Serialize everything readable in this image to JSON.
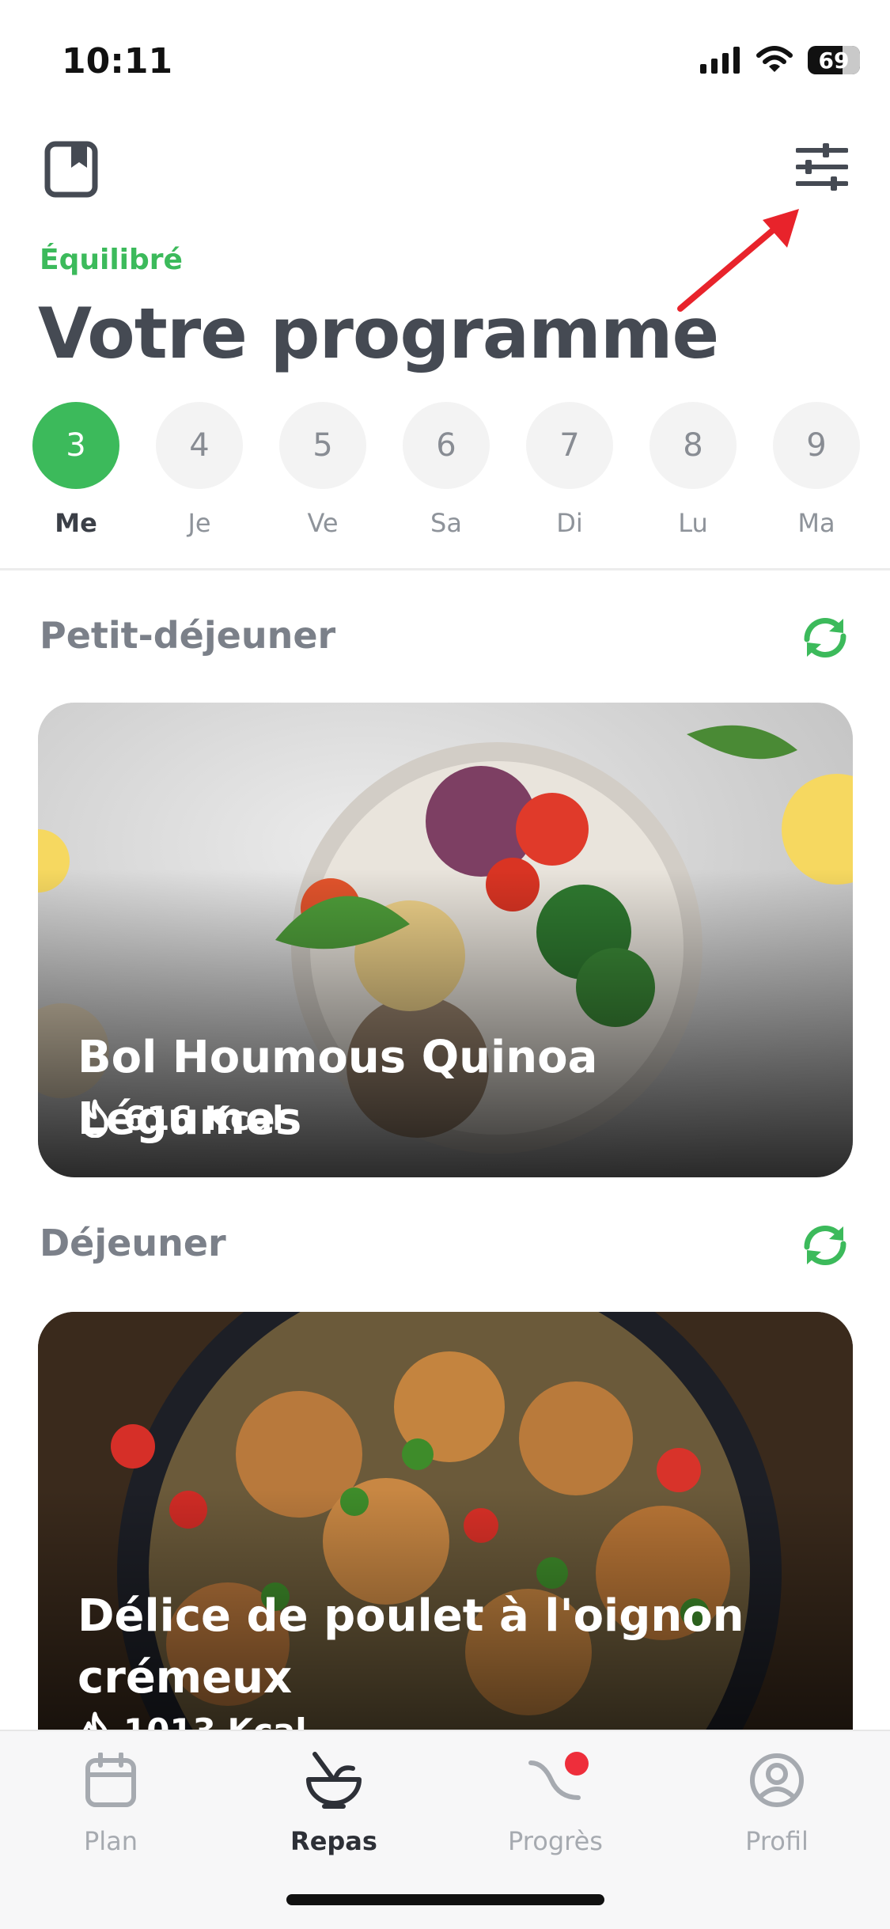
{
  "status_bar": {
    "time": "10:11",
    "battery": "69"
  },
  "header": {
    "subtitle": "Équilibré",
    "title": "Votre programme"
  },
  "days": [
    {
      "number": "3",
      "label": "Me",
      "active": true
    },
    {
      "number": "4",
      "label": "Je",
      "active": false
    },
    {
      "number": "5",
      "label": "Ve",
      "active": false
    },
    {
      "number": "6",
      "label": "Sa",
      "active": false
    },
    {
      "number": "7",
      "label": "Di",
      "active": false
    },
    {
      "number": "8",
      "label": "Lu",
      "active": false
    },
    {
      "number": "9",
      "label": "Ma",
      "active": false
    }
  ],
  "meals": [
    {
      "section": "Petit-déjeuner",
      "name": "Bol Houmous Quinoa Légumes",
      "kcal": "616 Kcal"
    },
    {
      "section": "Déjeuner",
      "name": "Délice de poulet à l'oignon crémeux",
      "kcal": "1013 Kcal"
    }
  ],
  "tabbar": [
    {
      "label": "Plan",
      "icon": "calendar-icon"
    },
    {
      "label": "Repas",
      "icon": "bowl-icon"
    },
    {
      "label": "Progrès",
      "icon": "progress-icon"
    },
    {
      "label": "Profil",
      "icon": "profile-icon"
    }
  ],
  "colors": {
    "accent": "#3cba5b",
    "annotation": "#e8232b",
    "title": "#454a53",
    "notification": "#ee2e3b"
  }
}
